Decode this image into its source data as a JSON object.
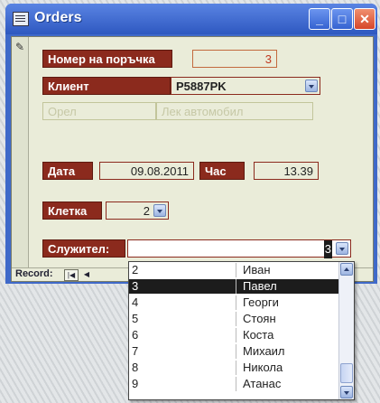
{
  "window": {
    "title": "Orders"
  },
  "fields": {
    "order_number": {
      "label": "Номер на поръчка",
      "value": "3"
    },
    "client": {
      "label": "Клиент",
      "value": "P5887PK"
    },
    "client_city": "Орел",
    "client_vehicle": "Лек автомобил",
    "date": {
      "label": "Дата",
      "value": "09.08.2011"
    },
    "time": {
      "label": "Час",
      "value": "13.39"
    },
    "cage": {
      "label": "Клетка",
      "value": "2"
    },
    "employee": {
      "label": "Служител:",
      "value": "3"
    }
  },
  "navigation": {
    "record_label": "Record:",
    "first_icon": "first-record-icon",
    "prev_icon": "previous-record-icon"
  },
  "employee_list": {
    "selected_index": 1,
    "rows": [
      {
        "id": "2",
        "name": "Иван"
      },
      {
        "id": "3",
        "name": "Павел"
      },
      {
        "id": "4",
        "name": "Георги"
      },
      {
        "id": "5",
        "name": "Стоян"
      },
      {
        "id": "6",
        "name": "Коста"
      },
      {
        "id": "7",
        "name": "Михаил"
      },
      {
        "id": "8",
        "name": "Никола"
      },
      {
        "id": "9",
        "name": "Атанас"
      }
    ]
  },
  "colors": {
    "label_bg": "#8b2a1d",
    "form_bg": "#eaecd9",
    "titlebar": "#3f69c9",
    "selection": "#1c1c1c"
  }
}
